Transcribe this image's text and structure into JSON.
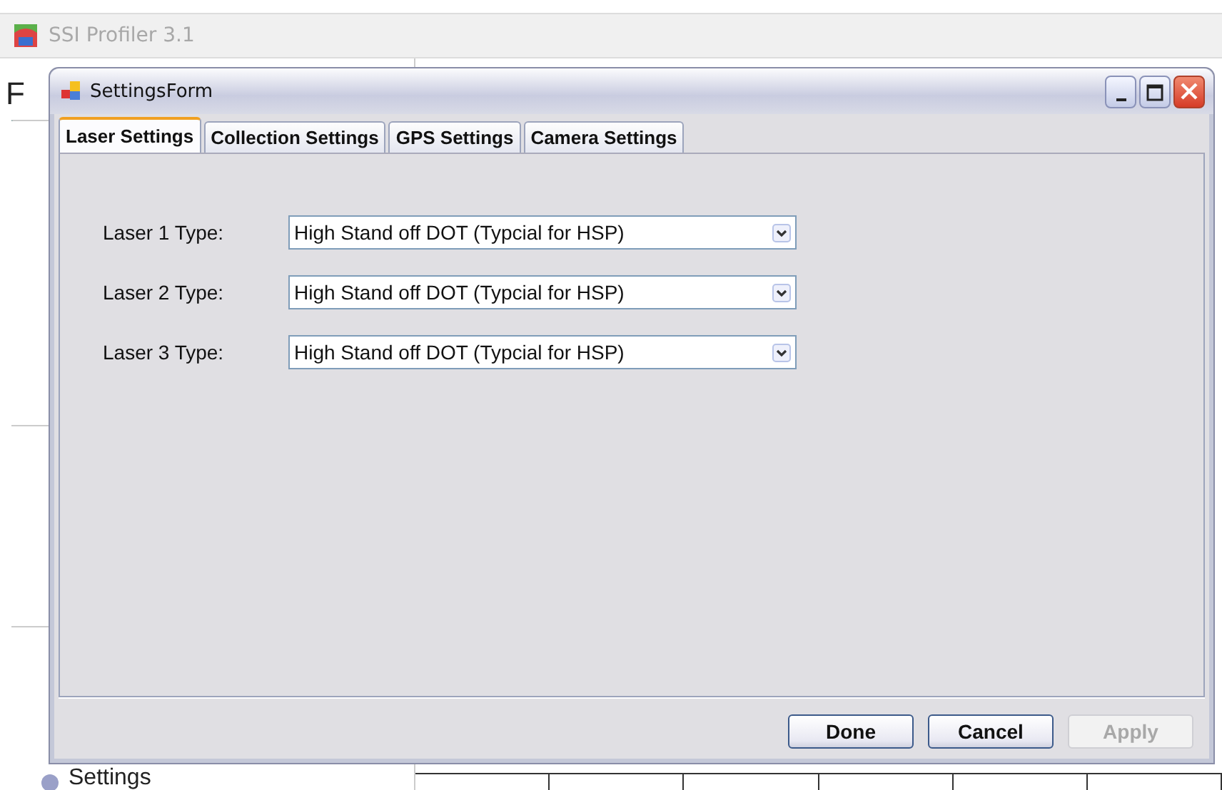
{
  "app": {
    "title": "SSI Profiler 3.1",
    "menu_letter": "F",
    "sidebar_label": "Settings"
  },
  "dialog": {
    "title": "SettingsForm",
    "tabs": [
      {
        "label": "Laser Settings",
        "selected": true
      },
      {
        "label": "Collection Settings",
        "selected": false
      },
      {
        "label": "GPS Settings",
        "selected": false
      },
      {
        "label": "Camera Settings",
        "selected": false
      }
    ],
    "fields": [
      {
        "label": "Laser 1 Type:",
        "value": "High Stand off DOT (Typcial for HSP)"
      },
      {
        "label": "Laser 2 Type:",
        "value": "High Stand off DOT (Typcial for HSP)"
      },
      {
        "label": "Laser 3 Type:",
        "value": "High Stand off DOT (Typcial for HSP)"
      }
    ],
    "buttons": [
      {
        "label": "Done",
        "disabled": false
      },
      {
        "label": "Cancel",
        "disabled": false
      },
      {
        "label": "Apply",
        "disabled": true
      }
    ]
  }
}
